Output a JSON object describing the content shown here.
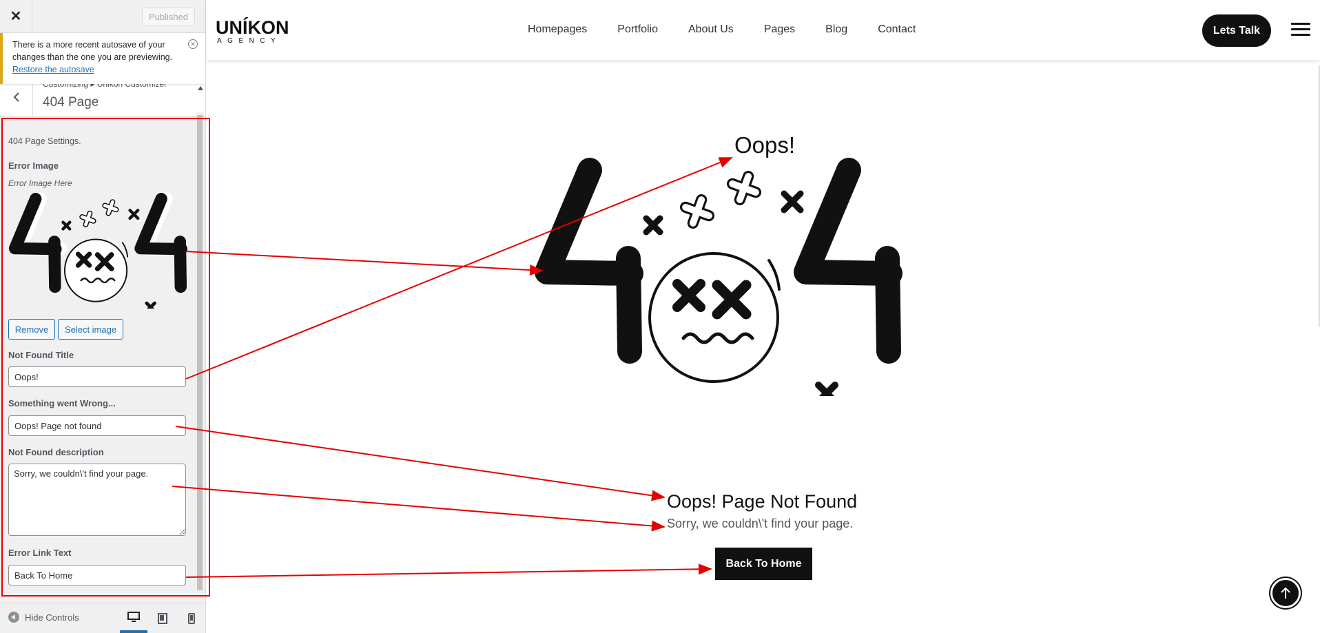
{
  "panel": {
    "close_label": "✕",
    "publish_label": "Published",
    "autosave": {
      "message": "There is a more recent autosave of your changes than the one you are previewing.",
      "link": "Restore the autosave"
    },
    "breadcrumb": "Customizing ▸ Unikon Customizer",
    "section_title": "404 Page",
    "section_description": "404 Page Settings.",
    "error_image": {
      "label": "Error Image",
      "sublabel": "Error Image Here",
      "remove_label": "Remove",
      "select_label": "Select image"
    },
    "not_found_title": {
      "label": "Not Found Title",
      "value": "Oops!"
    },
    "something_wrong": {
      "label": "Something went Wrong...",
      "value": "Oops! Page not found"
    },
    "not_found_description": {
      "label": "Not Found description",
      "value": "Sorry, we couldn\\'t find your page."
    },
    "error_link_text": {
      "label": "Error Link Text",
      "value": "Back To Home"
    },
    "footer": {
      "hide_controls": "Hide Controls"
    }
  },
  "site": {
    "logo": "UNÍKON",
    "logo_sub": "AGENCY",
    "nav": [
      "Homepages",
      "Portfolio",
      "About Us",
      "Pages",
      "Blog",
      "Contact"
    ],
    "cta": "Lets Talk"
  },
  "error_page": {
    "title": "Oops!",
    "heading": "Oops! Page Not Found",
    "description": "Sorry, we couldn\\'t find your page.",
    "button": "Back To Home"
  },
  "colors": {
    "accent": "#2271b1",
    "highlight": "#e50000",
    "notice": "#dba617",
    "dark": "#111111"
  }
}
